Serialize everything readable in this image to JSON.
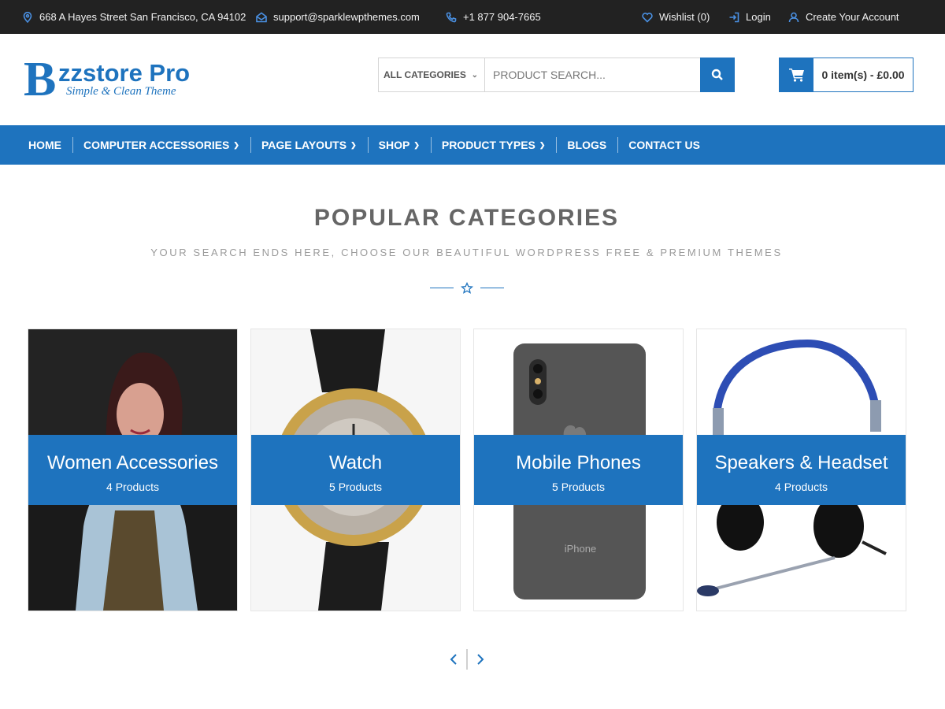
{
  "topbar": {
    "address": "668 A Hayes Street San Francisco, CA 94102",
    "email": "support@sparklewpthemes.com",
    "phone": "+1 877 904-7665",
    "wishlist": "Wishlist (0)",
    "login": "Login",
    "create_account": "Create Your Account"
  },
  "logo": {
    "letter": "B",
    "title": "zzstore Pro",
    "tagline": "Simple & Clean Theme"
  },
  "search": {
    "category": "ALL CATEGORIES",
    "placeholder": "PRODUCT SEARCH..."
  },
  "cart": {
    "label": "0 item(s) - £0.00"
  },
  "nav": {
    "items": [
      {
        "label": "HOME"
      },
      {
        "label": "COMPUTER ACCESSORIES"
      },
      {
        "label": "PAGE LAYOUTS"
      },
      {
        "label": "SHOP"
      },
      {
        "label": "PRODUCT TYPES"
      },
      {
        "label": "BLOGS"
      },
      {
        "label": "CONTACT US"
      }
    ]
  },
  "section": {
    "title": "POPULAR CATEGORIES",
    "subtitle": "YOUR SEARCH ENDS HERE, CHOOSE OUR BEAUTIFUL WORDPRESS FREE & PREMIUM THEMES"
  },
  "categories": [
    {
      "name": "Women Accessories",
      "count": "4 Products"
    },
    {
      "name": "Watch",
      "count": "5 Products"
    },
    {
      "name": "Mobile Phones",
      "count": "5 Products"
    },
    {
      "name": "Speakers & Headset",
      "count": "4 Products"
    }
  ],
  "phone_image_text": "iPhone",
  "colors": {
    "accent": "#1e73be",
    "topbar": "#222222"
  }
}
